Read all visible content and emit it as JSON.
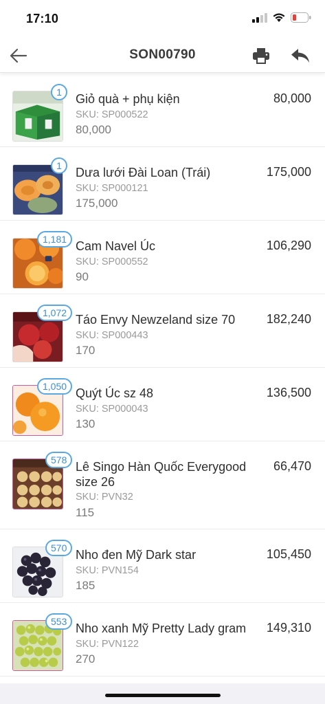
{
  "status_bar": {
    "time": "17:10"
  },
  "header": {
    "title": "SON00790"
  },
  "icons": {
    "back": "arrow-left-icon",
    "print": "printer-icon",
    "reply": "reply-icon"
  },
  "colors": {
    "badge": "#5aa8e0",
    "badge_text": "#3b8fd4",
    "battery_low": "#e0443c"
  },
  "items": [
    {
      "name": "Giỏ quà + phụ kiện",
      "sku": "SKU: SP000522",
      "quantity": "80,000",
      "price": "80,000",
      "badge": "1"
    },
    {
      "name": "Dưa lưới Đài Loan (Trái)",
      "sku": "SKU: SP000121",
      "quantity": "175,000",
      "price": "175,000",
      "badge": "1"
    },
    {
      "name": "Cam Navel Úc",
      "sku": "SKU: SP000552",
      "quantity": "90",
      "price": "106,290",
      "badge": "1,181"
    },
    {
      "name": "Táo Envy Newzeland size 70",
      "sku": "SKU: SP000443",
      "quantity": "170",
      "price": "182,240",
      "badge": "1,072"
    },
    {
      "name": "Quýt Úc sz 48",
      "sku": "SKU: SP000043",
      "quantity": "130",
      "price": "136,500",
      "badge": "1,050"
    },
    {
      "name": "Lê Singo Hàn Quốc Everygood size 26",
      "sku": "SKU: PVN32",
      "quantity": "115",
      "price": "66,470",
      "badge": "578"
    },
    {
      "name": "Nho đen Mỹ Dark star",
      "sku": "SKU: PVN154",
      "quantity": "185",
      "price": "105,450",
      "badge": "570"
    },
    {
      "name": "Nho xanh Mỹ Pretty Lady gram",
      "sku": "SKU: PVN122",
      "quantity": "270",
      "price": "149,310",
      "badge": "553"
    }
  ]
}
